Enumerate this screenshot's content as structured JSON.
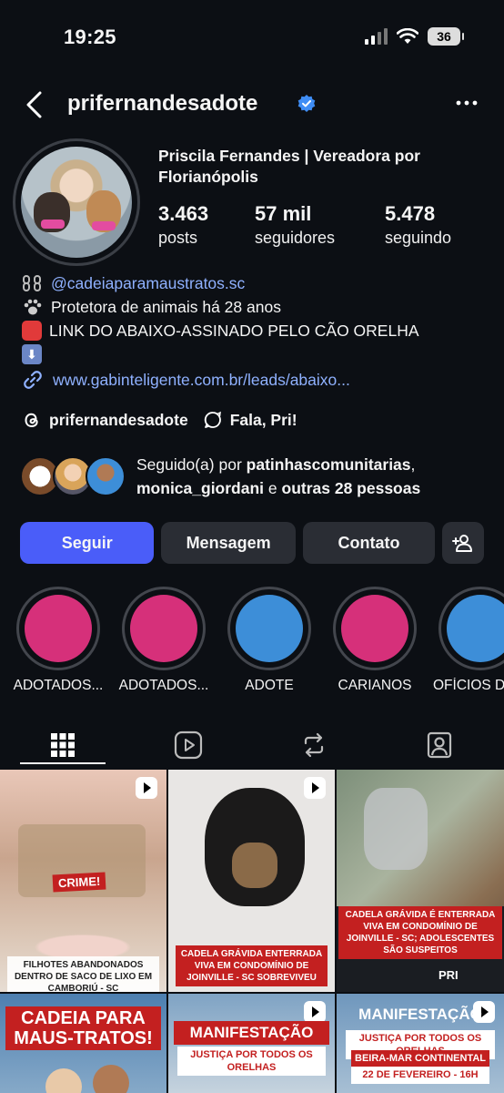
{
  "status": {
    "time": "19:25",
    "battery": "36"
  },
  "header": {
    "username": "prifernandesadote"
  },
  "profile": {
    "full_name": "Priscila Fernandes | Vereadora por Florianópolis",
    "stats": [
      {
        "value": "3.463",
        "label": "posts"
      },
      {
        "value": "57 mil",
        "label": "seguidores"
      },
      {
        "value": "5.478",
        "label": "seguindo"
      }
    ]
  },
  "bio": {
    "mention": "@cadeiaparamaustratos.sc",
    "line2": "Protetora de animais há 28 anos",
    "line3": "LINK DO ABAIXO-ASSINADO PELO CÃO ORELHA",
    "arrow": "⬇",
    "link": "www.gabinteligente.com.br/leads/abaixo..."
  },
  "threads": {
    "handle": "prifernandesadote",
    "chat": "Fala, Pri!"
  },
  "followed_by": {
    "prefix": "Seguido(a) por ",
    "user1": "patinhascomunitarias",
    "sep": ",",
    "user2": "monica_giordani",
    "and": " e ",
    "others": "outras 28 pessoas"
  },
  "actions": {
    "follow": "Seguir",
    "message": "Mensagem",
    "contact": "Contato"
  },
  "highlights": [
    {
      "label": "ADOTADOS...",
      "color": "#d6307a"
    },
    {
      "label": "ADOTADOS...",
      "color": "#d6307a"
    },
    {
      "label": "ADOTE",
      "color": "#3d8ed8"
    },
    {
      "label": "CARIANOS",
      "color": "#d6307a"
    },
    {
      "label": "OFÍCIOS D",
      "color": "#3d8ed8"
    }
  ],
  "posts": {
    "p1_tag": "CRIME!",
    "p1_caption": "FILHOTES ABANDONADOS DENTRO DE SACO DE LIXO EM CAMBORIÚ - SC",
    "p2_caption": "CADELA GRÁVIDA ENTERRADA VIVA EM CONDOMÍNIO DE JOINVILLE - SC SOBREVIVEU",
    "p3_caption": "CADELA GRÁVIDA É ENTERRADA VIVA EM CONDOMÍNIO DE JOINVILLE - SC; ADOLESCENTES SÃO SUSPEITOS",
    "p3_logo": "PRI",
    "p4_title": "CADEIA PARA MAUS-TRATOS!",
    "p5_title": "MANIFESTAÇÃO",
    "p5_sub": "JUSTIÇA POR TODOS OS ORELHAS",
    "p6_title": "MANIFESTAÇÃO",
    "p6_sub": "JUSTIÇA POR TODOS OS ORELHAS",
    "p6_place": "BEIRA-MAR CONTINENTAL",
    "p6_date": "22 DE FEVEREIRO - 16H"
  }
}
